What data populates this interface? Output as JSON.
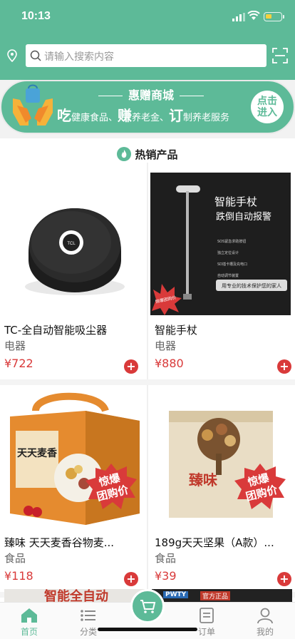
{
  "status": {
    "time": "10:13"
  },
  "search": {
    "placeholder": "请输入搜索内容"
  },
  "banner": {
    "title": "惠赠商城",
    "sub_parts": [
      {
        "big": "吃",
        "small": "健康食品、"
      },
      {
        "big": "赚",
        "small": "养老金、"
      },
      {
        "big": "订",
        "small": "制养老服务"
      }
    ],
    "enter_line1": "点击",
    "enter_line2": "进入"
  },
  "section": {
    "title": "热销产品"
  },
  "products": [
    {
      "name": "TC-全自动智能吸尘器",
      "category": "电器",
      "price": "¥722",
      "badge": "",
      "image_text": "TCL"
    },
    {
      "name": "智能手杖",
      "category": "电器",
      "price": "¥880",
      "badge": "惊爆团购价",
      "image_title": "智能手杖",
      "image_subtitle": "跌倒自动报警",
      "image_features": [
        "SOS紧急求助按钮",
        "独立定位设计",
        "SD插卡槽及充电口",
        "自动调节装置"
      ],
      "image_caption": "用专业的技术保护您的家人"
    },
    {
      "name": "臻味 天天麦香谷物麦...",
      "category": "食品",
      "price": "¥118",
      "badge_line1": "惊爆",
      "badge_line2": "团购价",
      "image_text": "天天麦香"
    },
    {
      "name": "189g天天坚果（A款）...",
      "category": "食品",
      "price": "¥39",
      "badge_line1": "惊爆",
      "badge_line2": "团购价",
      "image_text": "臻味"
    }
  ],
  "peek": {
    "left_text": "智能全自动",
    "right_brand": "PWTY",
    "right_label": "官方正品"
  },
  "tabbar": [
    {
      "label": "首页",
      "icon": "home-icon",
      "active": true
    },
    {
      "label": "分类",
      "icon": "list-icon",
      "active": false
    },
    {
      "label": "",
      "icon": "cart-icon",
      "active": false
    },
    {
      "label": "订单",
      "icon": "order-icon",
      "active": false
    },
    {
      "label": "我的",
      "icon": "user-icon",
      "active": false
    }
  ],
  "colors": {
    "brand": "#5dba98",
    "price": "#d93a3a"
  }
}
